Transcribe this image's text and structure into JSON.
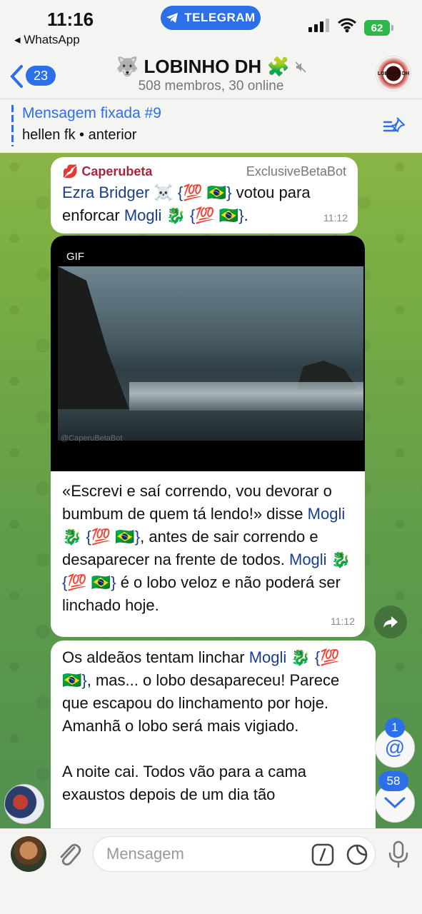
{
  "status_bar": {
    "time": "11:16",
    "back_app": "◂ WhatsApp",
    "telegram_pill": "TELEGRAM",
    "battery": "62"
  },
  "header": {
    "unread_count": "23",
    "title": "LOBINHO DH",
    "subtitle": "508 membros, 30 online",
    "avatar_text": "LOBINHO DH"
  },
  "pinned": {
    "title": "Mensagem fixada #9",
    "text": "hellen fk • anterior"
  },
  "messages": [
    {
      "sender": "💋 Caperubeta",
      "via": "ExclusiveBetaBot",
      "parts": [
        "Ezra Bridger ☠️ {💯 🇧🇷}",
        " votou para enforcar ",
        "Mogli 🐉 {💯 🇧🇷}",
        "."
      ],
      "time": "11:12"
    },
    {
      "gif_label": "GIF",
      "watermark": "@CaperuBetaBot",
      "parts": [
        "«Escrevi e saí correndo, vou devorar o bumbum de quem tá lendo!» disse ",
        "Mogli 🐉 {💯 🇧🇷}",
        ", antes de sair correndo e desaparecer na frente de todos. ",
        "Mogli 🐉 {💯 🇧🇷}",
        " é o lobo veloz e não poderá ser linchado hoje."
      ],
      "time": "11:12"
    },
    {
      "parts": [
        "Os aldeãos tentam linchar ",
        "Mogli 🐉 {💯 🇧🇷}",
        ", mas... o lobo desapareceu! Parece que escapou do linchamento por hoje. Amanhã o lobo será mais vigiado."
      ],
      "para2": "A noite cai. Todos vão para a cama exaustos depois de um dia tão"
    }
  ],
  "floating": {
    "mention_count": "1",
    "mention_symbol": "@",
    "unread_down_count": "58"
  },
  "composer": {
    "placeholder": "Mensagem"
  },
  "colors": {
    "accent": "#2d6fe8",
    "mention": "#1a3f8a",
    "sender": "#a8263b"
  }
}
